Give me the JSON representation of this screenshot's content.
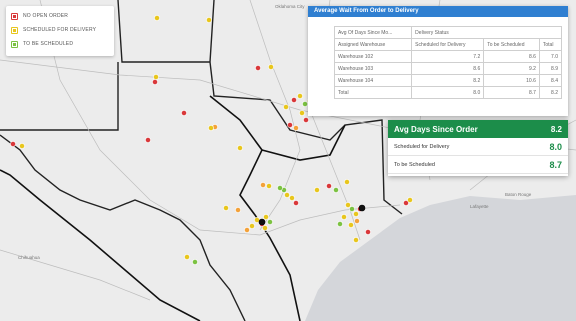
{
  "legend": {
    "items": [
      {
        "label": "NO OPEN ORDER",
        "color": "#d9383a"
      },
      {
        "label": "SCHEDULED FOR DELIVERY",
        "color": "#e8c61d"
      },
      {
        "label": "TO BE SCHEDULED",
        "color": "#7cc242"
      }
    ]
  },
  "wait_table": {
    "title": "Average Wait From Order to Delivery",
    "header1": [
      "Avg Of Days Since Mo...",
      "Delivery Status",
      "",
      ""
    ],
    "header2": [
      "Assigned Warehouse",
      "Scheduled for Delivery",
      "To be Scheduled",
      "Total"
    ],
    "rows": [
      [
        "Warehouse 102",
        "7.2",
        "8.6",
        "7.0"
      ],
      [
        "Warehouse 103",
        "8.6",
        "9.2",
        "8.9"
      ],
      [
        "Warehouse 104",
        "8.2",
        "10.6",
        "8.4"
      ],
      [
        "Total",
        "8.0",
        "8.7",
        "8.2"
      ]
    ]
  },
  "kpi": {
    "title": "Avg Days Since Order",
    "total": "8.2",
    "rows": [
      {
        "label": "Scheduled for Delivery",
        "value": "8.0"
      },
      {
        "label": "To be Scheduled",
        "value": "8.7"
      }
    ]
  },
  "map_labels": {
    "oklahoma": "Oklahoma City",
    "chihuahua": "Chihuahua",
    "baton_rouge": "Baton Rouge",
    "lafayette": "Lafayette"
  }
}
